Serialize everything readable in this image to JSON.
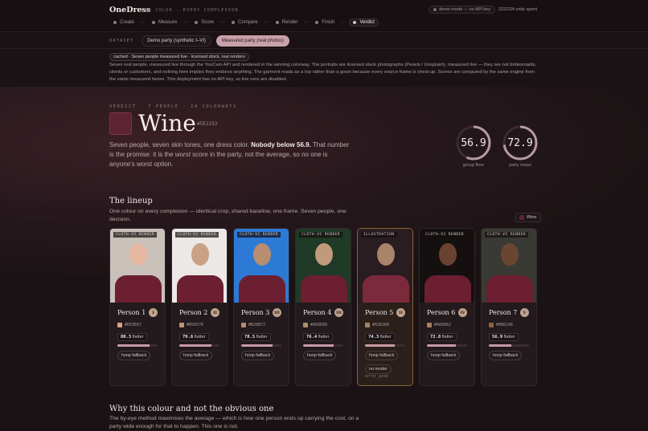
{
  "app": {
    "brand": "OneDress",
    "tagline": "ONE COLOR · EVERY COMPLEXION"
  },
  "status": {
    "mode": "demo mode — no API key",
    "units": "222/224 units spent"
  },
  "steps": [
    {
      "label": "Create"
    },
    {
      "label": "Measure"
    },
    {
      "label": "Score"
    },
    {
      "label": "Compare"
    },
    {
      "label": "Render"
    },
    {
      "label": "Finish"
    },
    {
      "label": "Verdict",
      "active": true
    }
  ],
  "dataset": {
    "label": "DATASET",
    "options": [
      "Demo party (synthetic I–VI)",
      "Measured party (real photos)"
    ],
    "selected": "Measured party (real photos)"
  },
  "cached_badge": "cached · Seven people measured live · licensed stock, real renders",
  "note": "Seven real people, measured live through the YouCam API and rendered in the winning colorway. The portraits are licensed stock photographs (Pexels / Unsplash), measured live — they are not bridesmaids, clients or customers, and nothing here implies they endorse anything. The garment reads as a top rather than a gown because every source frame is chest-up. Scores are computed by the same engine from the same measured hexes. This deployment has no API key, so live runs are disabled.",
  "verdict": {
    "label": "VERDICT · 7 PEOPLE · 24 COLORWAYS",
    "name": "Wine",
    "hex": "#5E2233",
    "swatch": "#5E2233",
    "lede_a": "Seven people, seven skin tones, one dress color. ",
    "lede_b": "Nobody below 56.9.",
    "lede_c": " That number is the promise: it is the ",
    "lede_d": "worst",
    "lede_e": " score in the party, not the average, so no one is anyone's worst option.",
    "group_floor": "56.9",
    "group_floor_label": "group floor",
    "group_floor_value": 0.569,
    "party_mean": "72.9",
    "party_mean_label": "party mean",
    "party_mean_value": 0.729
  },
  "lineup": {
    "title": "The lineup",
    "subtitle": "One colour on every complexion — identical crop, shared baseline, one frame. Seven people, one decision.",
    "legend": "Wine",
    "people": [
      {
        "name": "Person 1",
        "badge": "I",
        "tag": "CLOTH-V2 RENDER",
        "hex": "#DE9E87",
        "score": "80.3",
        "score_label": "flatter",
        "score_value": 0.803,
        "fallback": "hoop fallback",
        "skin": "#e6b8a2",
        "bg": "#c9c0ba",
        "tone": "#DE9E87"
      },
      {
        "name": "Person 2",
        "badge": "II",
        "tag": "CLOTH-V2 RENDER",
        "hex": "#B99578",
        "score": "79.6",
        "score_label": "flatter",
        "score_value": 0.796,
        "fallback": "hoop fallback",
        "skin": "#c9a285",
        "bg": "#ece8e6",
        "tone": "#B99578"
      },
      {
        "name": "Person 3",
        "badge": "III",
        "tag": "CLOTH-V2 RENDER",
        "hex": "#B28B72",
        "score": "78.5",
        "score_label": "flatter",
        "score_value": 0.785,
        "fallback": "hoop fallback",
        "skin": "#b88d70",
        "bg": "#2d7ad6",
        "tone": "#B28B72"
      },
      {
        "name": "Person 4",
        "badge": "III",
        "tag": "CLOTH-V2 RENDER",
        "hex": "#AD8D6D",
        "score": "76.4",
        "score_label": "flatter",
        "score_value": 0.764,
        "fallback": "hoop fallback",
        "skin": "#c09a7a",
        "bg": "#1f3a26",
        "tone": "#AD8D6D"
      },
      {
        "name": "Person 5",
        "badge": "II",
        "tag": "ILLUSTRATION",
        "hex": "#A38368",
        "score": "74.3",
        "score_label": "flatter",
        "score_value": 0.743,
        "fallback": "hoop fallback",
        "no_render": "no render",
        "error": "error_pose",
        "skin": "#a88468",
        "bg": "#2a1d22",
        "tone": "#A38368",
        "illustration": true
      },
      {
        "name": "Person 6",
        "badge": "IV",
        "tag": "CLOTH-V2 RENDER",
        "hex": "#A68062",
        "score": "72.8",
        "score_label": "flatter",
        "score_value": 0.728,
        "fallback": "hoop fallback",
        "skin": "#6a4230",
        "bg": "#151010",
        "tone": "#A68062"
      },
      {
        "name": "Person 7",
        "badge": "V",
        "tag": "CLOTH-V2 RENDER",
        "hex": "#8B6246",
        "score": "56.9",
        "score_label": "flatter",
        "score_value": 0.569,
        "fallback": "hoop fallback",
        "skin": "#6a4632",
        "bg": "#3a3a34",
        "tone": "#8B6246"
      }
    ]
  },
  "why": {
    "title": "Why this colour and not the obvious one",
    "subtitle": "The by-eye method maximises the average — which is how one person ends up carrying the cost, on a party wide enough for that to happen. This one is not."
  }
}
